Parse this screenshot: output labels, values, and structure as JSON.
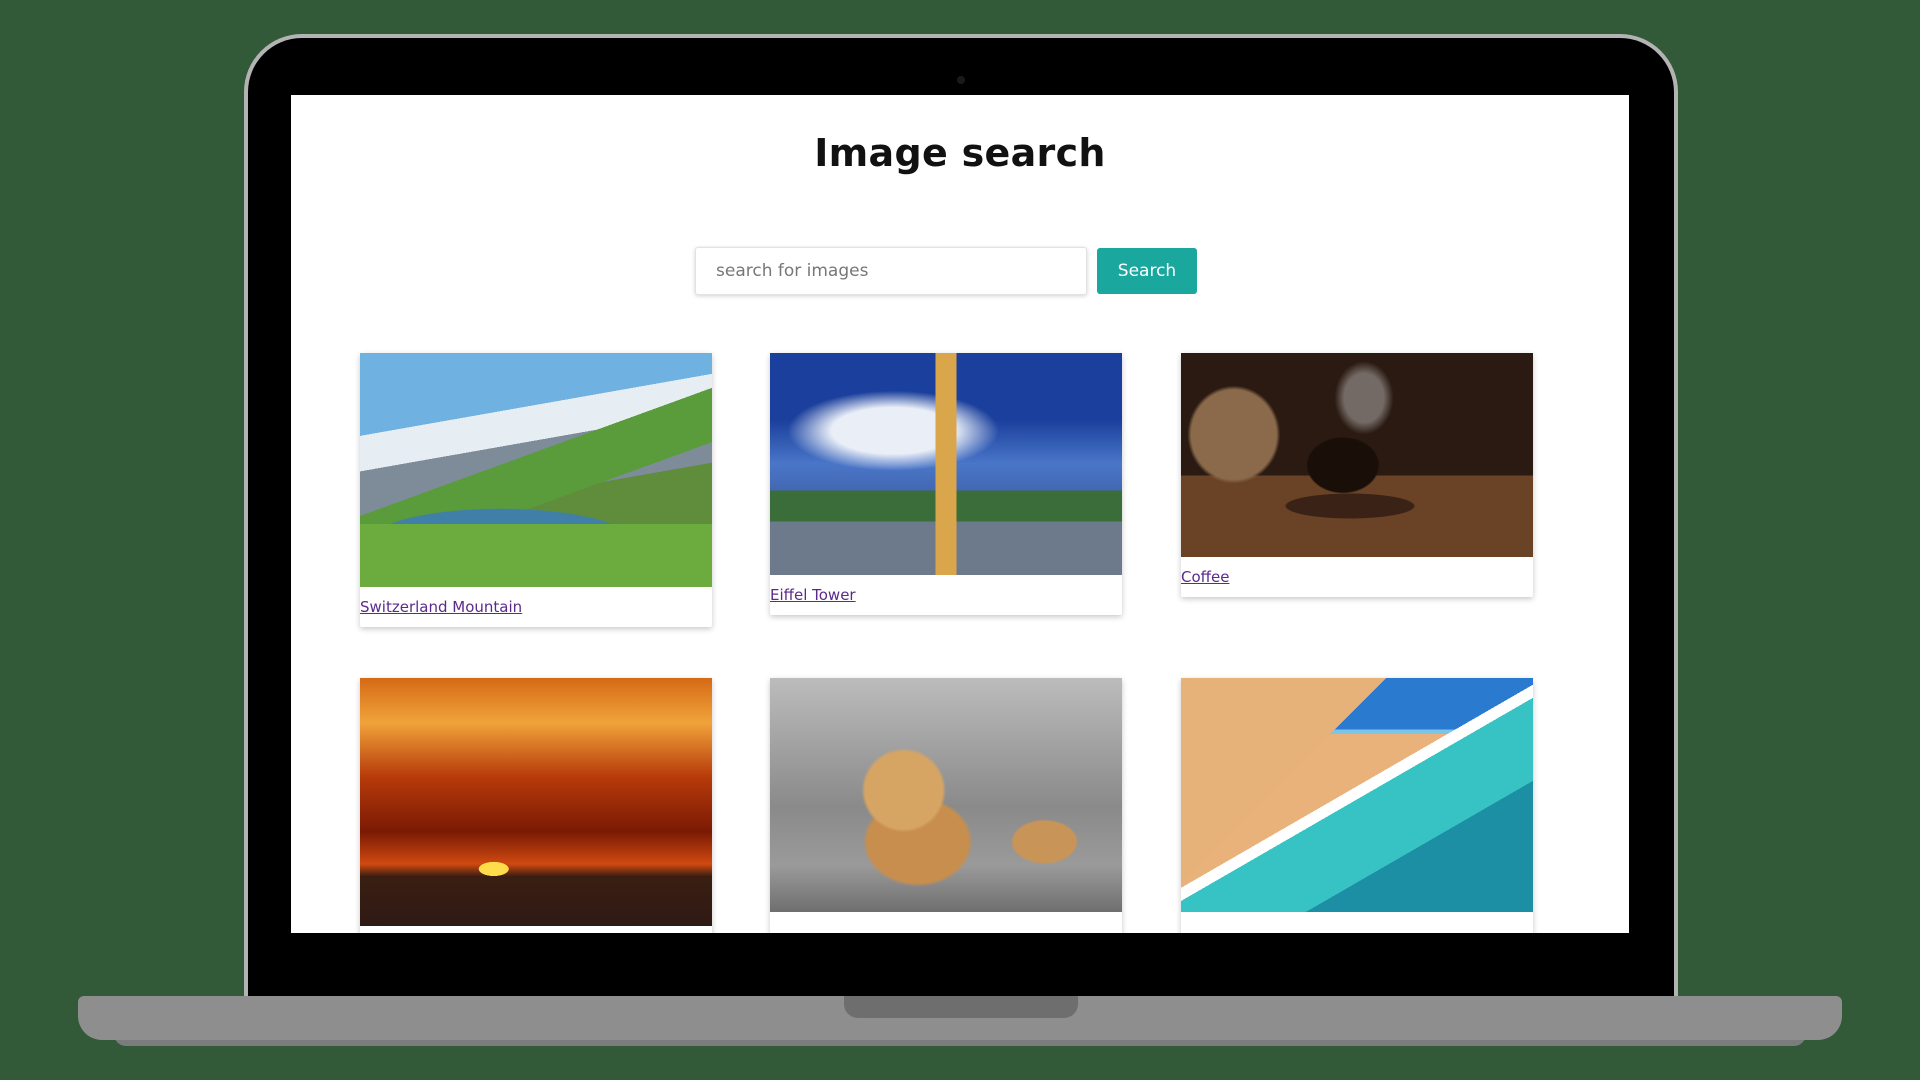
{
  "page": {
    "title": "Image search"
  },
  "search": {
    "placeholder": "search for images",
    "value": "",
    "button_label": "Search"
  },
  "results": [
    {
      "label": "Switzerland Mountain",
      "image": "mountain-lake-image"
    },
    {
      "label": "Eiffel Tower",
      "image": "eiffel-tower-image"
    },
    {
      "label": "Coffee",
      "image": "coffee-cup-image"
    },
    {
      "label": "",
      "image": "sunset-image"
    },
    {
      "label": "",
      "image": "persian-cat-image"
    },
    {
      "label": "",
      "image": "beach-image"
    }
  ],
  "colors": {
    "background": "#335a38",
    "button": "#1aa79e",
    "link": "#5b2a8c"
  }
}
